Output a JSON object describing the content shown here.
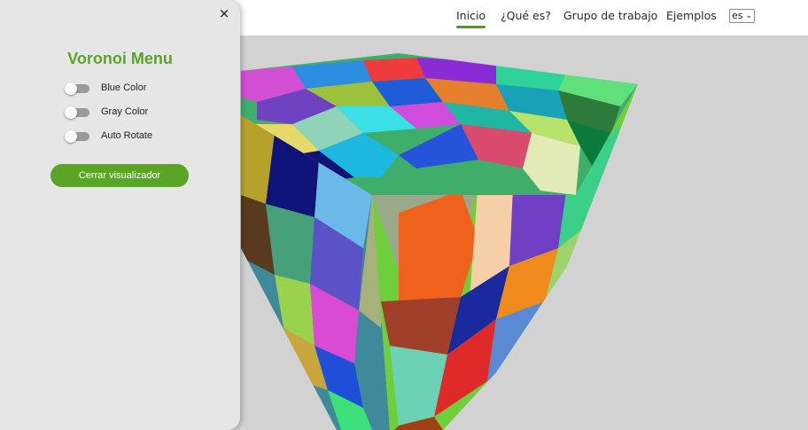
{
  "nav": {
    "links": [
      "Inicio",
      "¿Qué es?",
      "Grupo de trabajo",
      "Ejemplos"
    ],
    "active_link": "Inicio",
    "language": "es"
  },
  "drawer": {
    "close_icon": "×",
    "title": "Voronoi Menu",
    "toggles": [
      {
        "label": "Blue Color",
        "on": false
      },
      {
        "label": "Gray Color",
        "on": false
      },
      {
        "label": "Auto Rotate",
        "on": false
      }
    ],
    "close_button_label": "Cerrar visualizador"
  },
  "colors": {
    "accent": "#5aa428",
    "nav_underline": "#4f9d1a",
    "viewport_bg": "#d2d2d2"
  }
}
